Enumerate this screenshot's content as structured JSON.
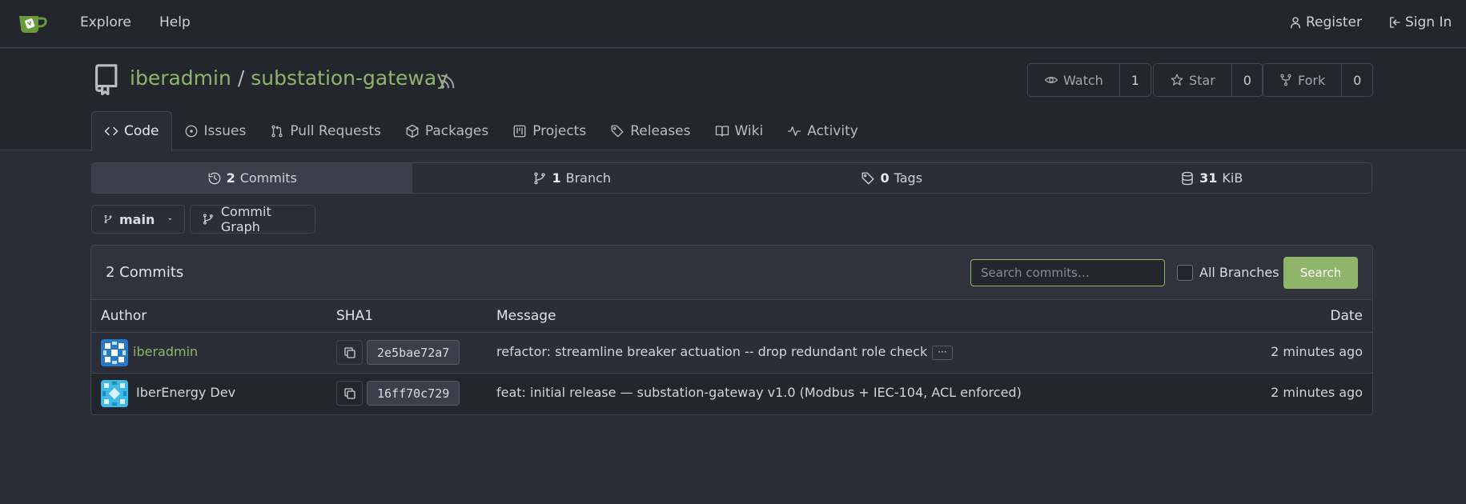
{
  "nav": {
    "explore": "Explore",
    "help": "Help",
    "register": "Register",
    "sign_in": "Sign In"
  },
  "repo": {
    "owner": "iberadmin",
    "separator": "/",
    "name": "substation-gateway",
    "watch_label": "Watch",
    "watch_count": "1",
    "star_label": "Star",
    "star_count": "0",
    "fork_label": "Fork",
    "fork_count": "0"
  },
  "tabs": [
    {
      "label": "Code",
      "icon": "code-icon"
    },
    {
      "label": "Issues",
      "icon": "issue-icon"
    },
    {
      "label": "Pull Requests",
      "icon": "pull-request-icon"
    },
    {
      "label": "Packages",
      "icon": "package-icon"
    },
    {
      "label": "Projects",
      "icon": "project-icon"
    },
    {
      "label": "Releases",
      "icon": "tag-icon"
    },
    {
      "label": "Wiki",
      "icon": "book-icon"
    },
    {
      "label": "Activity",
      "icon": "pulse-icon"
    }
  ],
  "stats": {
    "commits_count": "2",
    "commits_label": "Commits",
    "branch_count": "1",
    "branch_label": "Branch",
    "tags_count": "0",
    "tags_label": "Tags",
    "size_value": "31",
    "size_unit": "KiB"
  },
  "branch": {
    "current": "main",
    "graph_label": "Commit Graph"
  },
  "commits": {
    "title": "2 Commits",
    "search_placeholder": "Search commits…",
    "all_branches_label": "All Branches",
    "search_button": "Search",
    "columns": {
      "author": "Author",
      "sha": "SHA1",
      "message": "Message",
      "date": "Date"
    },
    "rows": [
      {
        "author": "iberadmin",
        "sha": "2e5bae72a7",
        "message": "refactor: streamline breaker actuation -- drop redundant role check",
        "ellipsis": "···",
        "date": "2 minutes ago"
      },
      {
        "author": "IberEnergy Dev",
        "sha": "16ff70c729",
        "message": "feat: initial release — substation-gateway v1.0 (Modbus + IEC-104, ACL enforced)",
        "date": "2 minutes ago"
      }
    ]
  },
  "colors": {
    "accent": "#8fb56b",
    "background": "#2b2e36",
    "header": "#23262d"
  }
}
